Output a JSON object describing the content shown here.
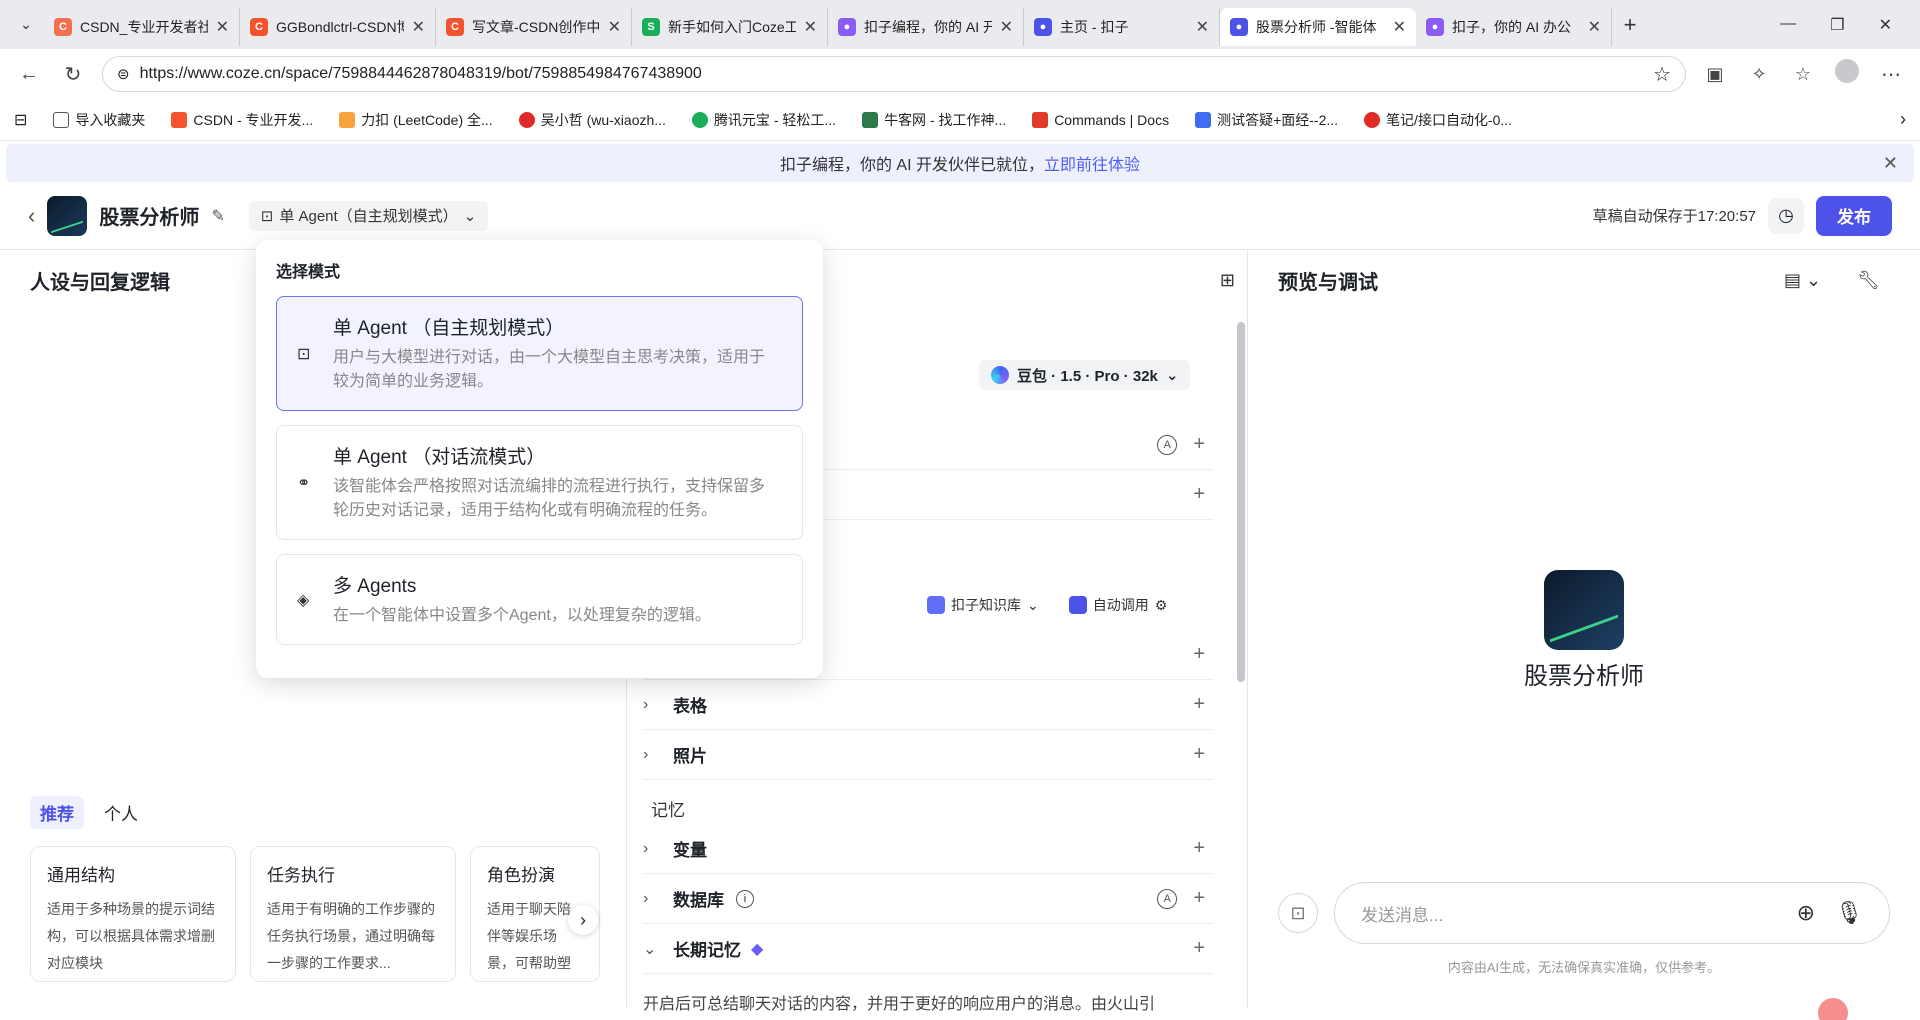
{
  "browser": {
    "tabs": [
      {
        "title": "CSDN_专业开发者社区",
        "color": "#f56f51",
        "glyph": "C"
      },
      {
        "title": "GGBondlctrl-CSDN博客",
        "color": "#f5532d",
        "glyph": "C"
      },
      {
        "title": "写文章-CSDN创作中心",
        "color": "#f5532d",
        "glyph": "C"
      },
      {
        "title": "新手如何入门Coze工作流",
        "color": "#1aad5a",
        "glyph": "S"
      },
      {
        "title": "扣子编程，你的 AI 开发伙伴",
        "color": "#8a5cf5",
        "glyph": "●"
      },
      {
        "title": "主页 - 扣子",
        "color": "#4d53e8",
        "glyph": "●"
      },
      {
        "title": "股票分析师 -智能体",
        "color": "#4d53e8",
        "glyph": "●"
      },
      {
        "title": "扣子，你的 AI 办公",
        "color": "#8a5cf5",
        "glyph": "●"
      }
    ],
    "url": "https://www.coze.cn/space/7598844462878048319/bot/7598854984767438900",
    "bookmarks": [
      {
        "label": "导入收藏夹",
        "color": "#555"
      },
      {
        "label": "CSDN - 专业开发...",
        "color": "#f5532d"
      },
      {
        "label": "力扣 (LeetCode) 全...",
        "color": "#f7a23b"
      },
      {
        "label": "吴小哲 (wu-xiaozh...",
        "color": "#e02a2a"
      },
      {
        "label": "腾讯元宝 - 轻松工...",
        "color": "#1aad5a"
      },
      {
        "label": "牛客网 - 找工作神...",
        "color": "#2c7a4b"
      },
      {
        "label": "Commands | Docs",
        "color": "#e23b2a"
      },
      {
        "label": "测试答疑+面经--2...",
        "color": "#3f6df0"
      },
      {
        "label": "笔记/接口自动化-0...",
        "color": "#e02a2a"
      }
    ]
  },
  "banner": {
    "text": "扣子编程，你的 AI 开发伙伴已就位，",
    "link": "立即前往体验"
  },
  "header": {
    "bot_name": "股票分析师",
    "mode": "单 Agent（自主规划模式）",
    "save_status": "草稿自动保存于17:20:57",
    "publish": "发布"
  },
  "persona": {
    "title": "人设与回复逻辑",
    "tabs": [
      "推荐",
      "个人"
    ],
    "cards": [
      {
        "title": "通用结构",
        "desc": "适用于多种场景的提示词结构，可以根据具体需求增删对应模块"
      },
      {
        "title": "任务执行",
        "desc": "适用于有明确的工作步骤的任务执行场景，通过明确每一步骤的工作要求..."
      },
      {
        "title": "角色扮演",
        "desc": "适用于聊天陪伴等娱乐场景，可帮助塑造个性化的人设"
      }
    ]
  },
  "skills": {
    "model": "豆包 · 1.5 · Pro · 32k",
    "kb_source": "扣子知识库",
    "auto_call": "自动调用",
    "rows": [
      {
        "label": "表格"
      },
      {
        "label": "照片"
      }
    ],
    "memory_label": "记忆",
    "memory_rows": [
      {
        "label": "变量"
      },
      {
        "label": "数据库"
      },
      {
        "label": "长期记忆"
      }
    ],
    "bottom_text": "开启后可总结聊天对话的内容，并用于更好的响应用户的消息。由火山引"
  },
  "preview": {
    "title": "预览与调试",
    "bot_name": "股票分析师",
    "placeholder": "发送消息...",
    "disclaimer": "内容由AI生成，无法确保真实准确，仅供参考。"
  },
  "mode_dropdown": {
    "title": "选择模式",
    "options": [
      {
        "name": "单 Agent （自主规划模式）",
        "desc": "用户与大模型进行对话，由一个大模型自主思考决策，适用于较为简单的业务逻辑。",
        "selected": true
      },
      {
        "name": "单 Agent （对话流模式）",
        "desc": "该智能体会严格按照对话流编排的流程进行执行，支持保留多轮历史对话记录，适用于结构化或有明确流程的任务。",
        "selected": false
      },
      {
        "name": "多 Agents",
        "desc": "在一个智能体中设置多个Agent，以处理复杂的逻辑。",
        "selected": false
      }
    ]
  },
  "colors": {
    "accent": "#4d53e8",
    "selected_border": "#6b74f2"
  }
}
